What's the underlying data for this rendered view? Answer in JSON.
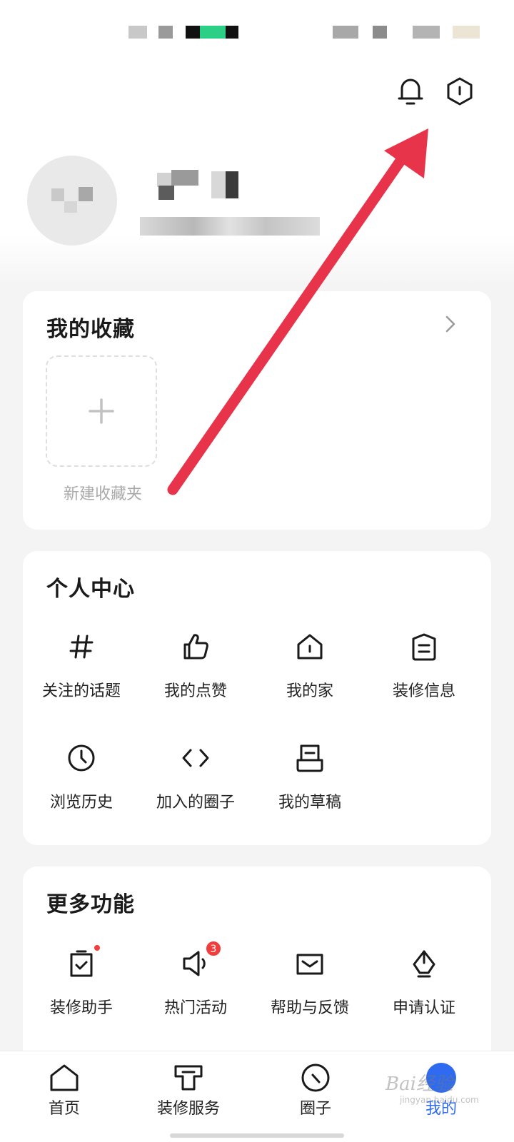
{
  "favorites": {
    "title": "我的收藏",
    "new_folder_label": "新建收藏夹"
  },
  "personal_center": {
    "title": "个人中心",
    "items": [
      {
        "label": "关注的话题",
        "icon": "hashtag-icon"
      },
      {
        "label": "我的点赞",
        "icon": "thumbs-up-icon"
      },
      {
        "label": "我的家",
        "icon": "home-icon"
      },
      {
        "label": "装修信息",
        "icon": "document-icon"
      },
      {
        "label": "浏览历史",
        "icon": "clock-icon"
      },
      {
        "label": "加入的圈子",
        "icon": "code-icon"
      },
      {
        "label": "我的草稿",
        "icon": "draft-icon"
      }
    ]
  },
  "more_features": {
    "title": "更多功能",
    "items": [
      {
        "label": "装修助手",
        "icon": "clipboard-check-icon",
        "badge_dot": true
      },
      {
        "label": "热门活动",
        "icon": "megaphone-icon",
        "badge_count": "3"
      },
      {
        "label": "帮助与反馈",
        "icon": "mail-icon"
      },
      {
        "label": "申请认证",
        "icon": "pen-nib-icon"
      }
    ]
  },
  "tab_bar": {
    "tabs": [
      {
        "label": "首页",
        "icon": "home-tab-icon",
        "active": false
      },
      {
        "label": "装修服务",
        "icon": "service-tab-icon",
        "active": false
      },
      {
        "label": "圈子",
        "icon": "circle-tab-icon",
        "active": false
      },
      {
        "label": "我的",
        "icon": "profile-tab-icon",
        "active": true
      }
    ]
  },
  "colors": {
    "accent_blue": "#2f6bf0",
    "annotation_red": "#e8344a",
    "badge_red": "#f23d3d"
  },
  "watermark": {
    "text": "Bai经验",
    "sub": "jingyan.baidu.com"
  }
}
